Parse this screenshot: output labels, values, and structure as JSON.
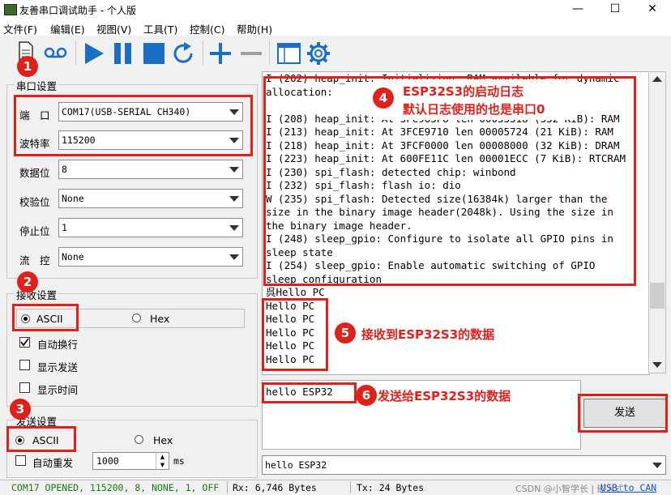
{
  "window": {
    "title": "友善串口调试助手 - 个人版",
    "minimize": "—",
    "maximize": "☐",
    "close": "✕"
  },
  "menu": [
    "文件(F)",
    "编辑(E)",
    "视图(V)",
    "工具(T)",
    "控制(C)",
    "帮助(H)"
  ],
  "toolbar": [
    "new-document-icon",
    "loop-icon",
    "play-icon",
    "pause-icon",
    "stop-icon",
    "refresh-icon",
    "add-icon",
    "remove-icon",
    "window-icon",
    "gear-icon"
  ],
  "serial_settings": {
    "title": "串口设置",
    "port_label": "端　口",
    "port_value": "COM17(USB-SERIAL CH340)",
    "baud_label": "波特率",
    "baud_value": "115200",
    "databits_label": "数据位",
    "databits_value": "8",
    "parity_label": "校验位",
    "parity_value": "None",
    "stopbits_label": "停止位",
    "stopbits_value": "1",
    "flow_label": "流　控",
    "flow_value": "None"
  },
  "receive_settings": {
    "title": "接收设置",
    "ascii": "ASCII",
    "hex": "Hex",
    "auto_newline": "自动换行",
    "show_send": "显示发送",
    "show_time": "显示时间"
  },
  "send_settings": {
    "title": "发送设置",
    "ascii": "ASCII",
    "hex": "Hex",
    "auto_resend": "自动重发",
    "interval": "1000",
    "unit": "ms"
  },
  "receive_log": [
    "I (202) heap_init: Initializing. RAM available for dynamic",
    "allocation:",
    "",
    "I (208) heap_init: At 3FC963F8 len 00053318 (332 KiB): RAM",
    "I (213) heap_init: At 3FCE9710 len 00005724 (21 KiB): RAM",
    "I (218) heap_init: At 3FCF0000 len 00008000 (32 KiB): DRAM",
    "I (223) heap_init: At 600FE11C len 00001ECC (7 KiB): RTCRAM",
    "I (230) spi_flash: detected chip: winbond",
    "I (232) spi_flash: flash io: dio",
    "W (235) spi_flash: Detected size(16384k) larger than the",
    "size in the binary image header(2048k). Using the size in",
    "the binary image header.",
    "I (248) sleep_gpio: Configure to isolate all GPIO pins in",
    "sleep state",
    "I (254) sleep_gpio: Enable automatic switching of GPIO",
    "sleep configuration",
    "呉Hello PC",
    "Hello PC",
    "Hello PC",
    "Hello PC",
    "Hello PC",
    "Hello PC"
  ],
  "send_text": "hello ESP32",
  "send_button": "发送",
  "history_value": "hello ESP32",
  "status": {
    "port": "COM17 OPENED, 115200, 8, NONE, 1, OFF",
    "rx": "Rx: 6,746 Bytes",
    "tx": "Tx: 24 Bytes",
    "watermark": "CSDN @小智学长 | 嵌入式",
    "link": "USB to CAN"
  },
  "annotations": {
    "n1": "1",
    "n2": "2",
    "n3": "3",
    "n4": "4",
    "n5": "5",
    "n6": "6",
    "t4a": "ESP32S3的启动日志",
    "t4b": "默认日志使用的也是串口0",
    "t5": "接收到ESP32S3的数据",
    "t6": "发送给ESP32S3的数据"
  },
  "colors": {
    "annotation_red": "#e0201b",
    "toolbar_blue": "#1a6fc4",
    "link_blue": "#1a4fd0"
  }
}
